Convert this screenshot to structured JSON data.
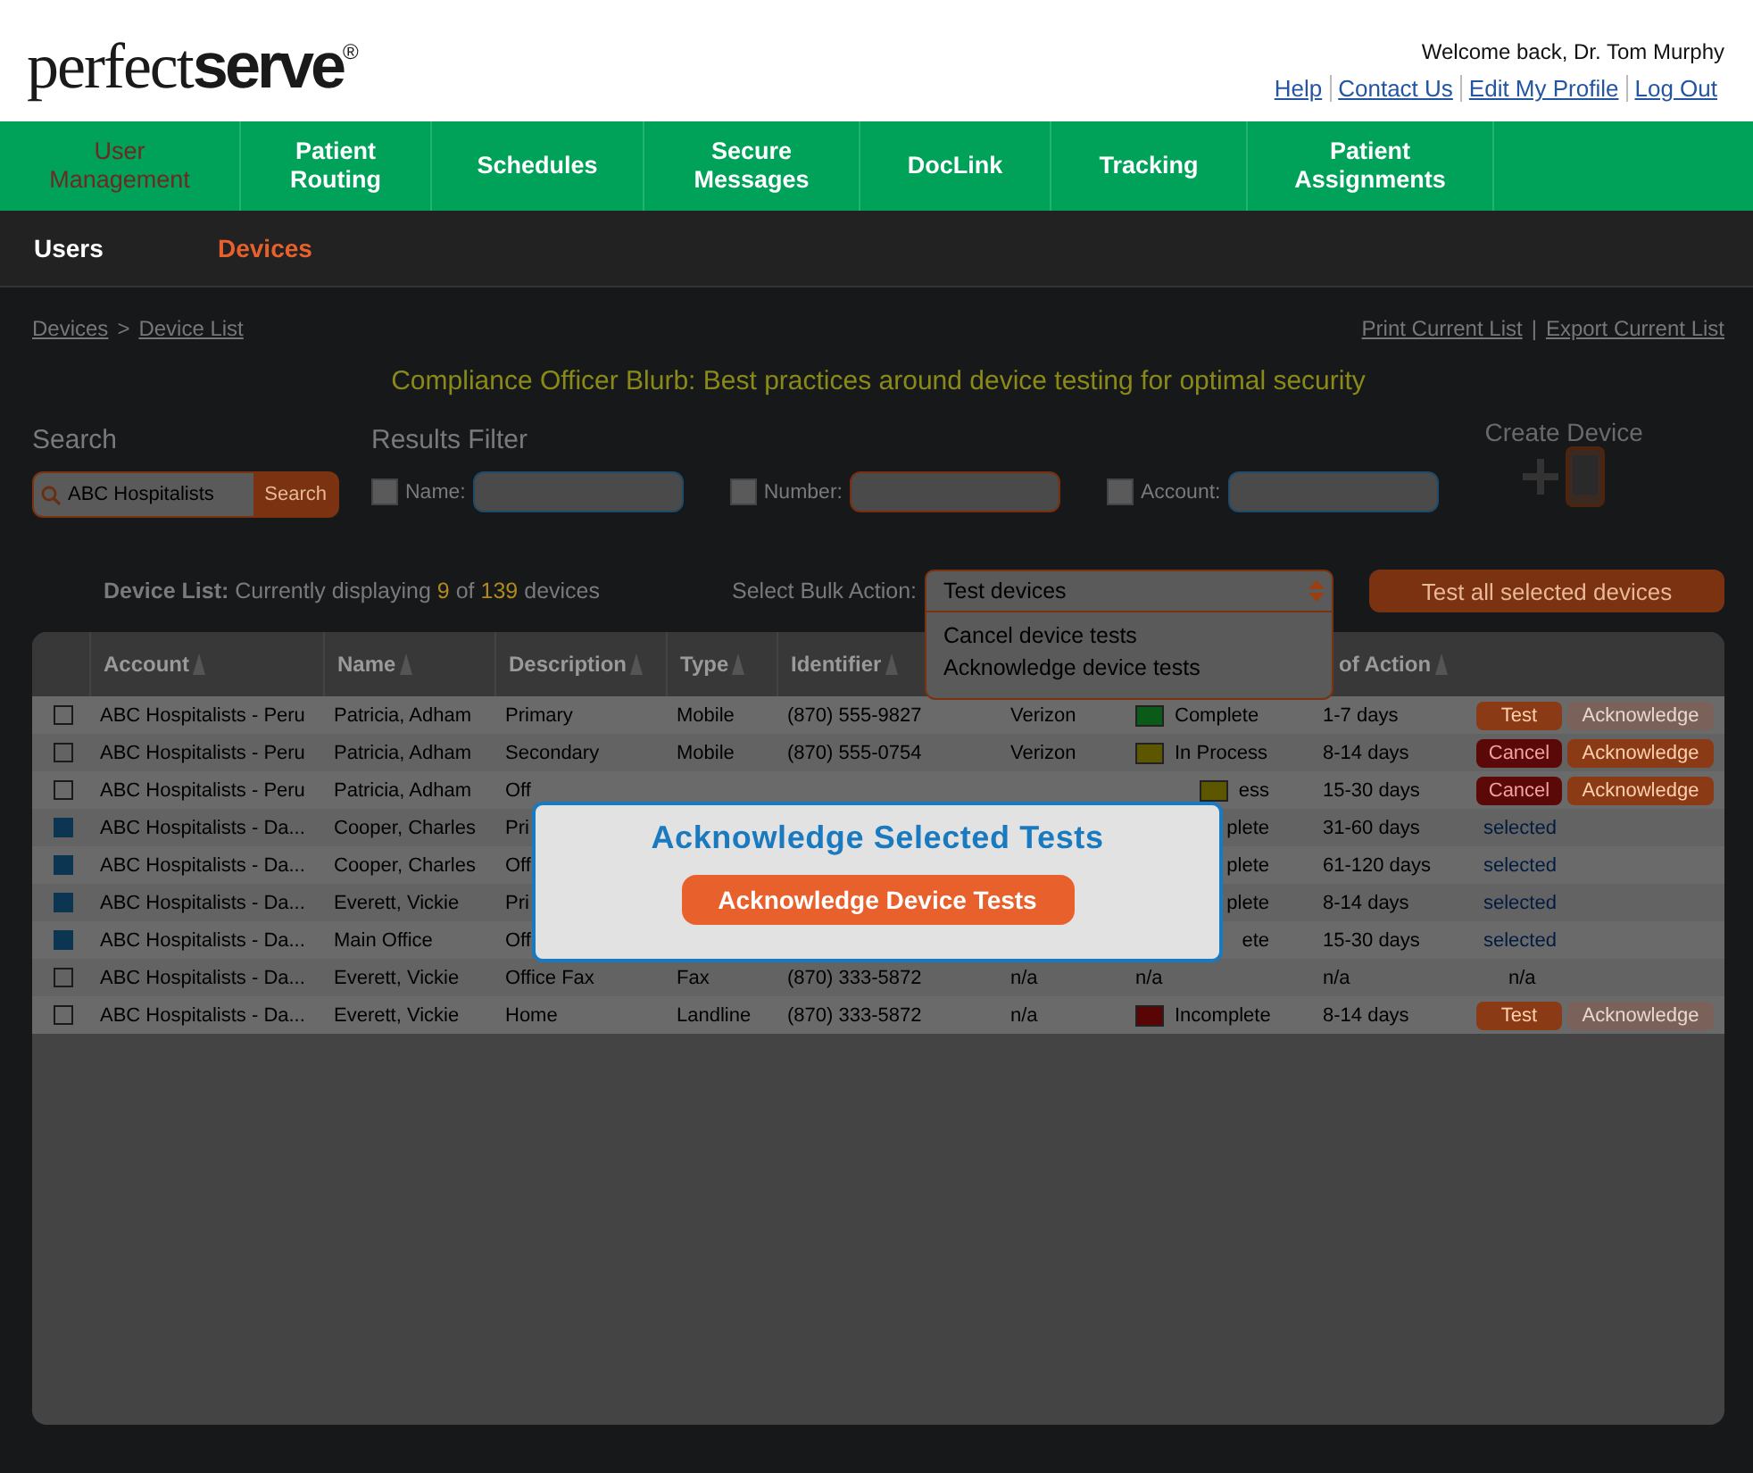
{
  "logo": {
    "light": "perfect",
    "bold": "serve",
    "mark": "®"
  },
  "welcome": "Welcome back, Dr. Tom Murphy",
  "top_links": [
    "Help",
    "Contact Us",
    "Edit My Profile",
    "Log Out"
  ],
  "nav": [
    {
      "label": "User Management",
      "selected": true
    },
    {
      "label": "Patient Routing",
      "selected": false
    },
    {
      "label": "Schedules",
      "selected": false
    },
    {
      "label": "Secure Messages",
      "selected": false
    },
    {
      "label": "DocLink",
      "selected": false
    },
    {
      "label": "Tracking",
      "selected": false
    },
    {
      "label": "Patient Assignments",
      "selected": false
    }
  ],
  "subnav": [
    {
      "label": "Users",
      "selected": false
    },
    {
      "label": "Devices",
      "selected": true
    }
  ],
  "breadcrumbs": {
    "items": [
      "Devices",
      "Device List"
    ],
    "separator": ">"
  },
  "list_links": {
    "items": [
      "Print Current List",
      "Export Current List"
    ],
    "separator": "|"
  },
  "blurb": "Compliance Officer Blurb: Best practices around device testing for optimal security",
  "search": {
    "label": "Search",
    "value": "ABC Hospitalists",
    "button": "Search"
  },
  "results_filter": {
    "label": "Results Filter",
    "filters": [
      {
        "label": "Name:",
        "checked": false,
        "color": "#1f4a6a"
      },
      {
        "label": "Number:",
        "checked": false,
        "color": "#7a2e10"
      },
      {
        "label": "Account:",
        "checked": false,
        "color": "#1f4a6a"
      }
    ]
  },
  "create_device": {
    "label": "Create Device"
  },
  "device_list": {
    "label": "Device List:",
    "prefix": "Currently displaying",
    "shown": "9",
    "middle": "of",
    "total": "139",
    "suffix": "devices"
  },
  "bulk_action": {
    "label": "Select Bulk Action:",
    "value": "Test devices",
    "options": [
      "Cancel device tests",
      "Acknowledge device tests"
    ],
    "button": "Test all selected devices"
  },
  "table": {
    "columns": [
      "Account",
      "Name",
      "Description",
      "Type",
      "Identifier",
      "of Action"
    ],
    "rows": [
      {
        "checked": false,
        "account": "ABC Hospitalists - Peru",
        "name": "Patricia, Adham",
        "description": "Primary",
        "type": "Mobile",
        "identifier": "(870) 555-9827",
        "carrier": "Verizon",
        "status": {
          "label": "Complete",
          "color": "#0b5a17"
        },
        "time": "1-7 days",
        "action": {
          "kind": "buttons",
          "buttons": [
            {
              "label": "Test",
              "kind": "test",
              "disabled": false
            },
            {
              "label": "Acknowledge",
              "kind": "acknowledge",
              "disabled": true
            }
          ]
        }
      },
      {
        "checked": false,
        "account": "ABC Hospitalists - Peru",
        "name": "Patricia, Adham",
        "description": "Secondary",
        "type": "Mobile",
        "identifier": "(870) 555-0754",
        "carrier": "Verizon",
        "status": {
          "label": "In Process",
          "color": "#5c5600"
        },
        "time": "8-14 days",
        "action": {
          "kind": "buttons",
          "buttons": [
            {
              "label": "Cancel",
              "kind": "cancel",
              "disabled": false
            },
            {
              "label": "Acknowledge",
              "kind": "acknowledge",
              "disabled": false
            }
          ]
        }
      },
      {
        "checked": false,
        "account": "ABC Hospitalists - Peru",
        "name": "Patricia, Adham",
        "description": "Off",
        "status": {
          "label": "ess",
          "color": "#5c5600"
        },
        "time": "15-30 days",
        "action": {
          "kind": "buttons",
          "buttons": [
            {
              "label": "Cancel",
              "kind": "cancel",
              "disabled": false
            },
            {
              "label": "Acknowledge",
              "kind": "acknowledge",
              "disabled": false
            }
          ]
        }
      },
      {
        "checked": true,
        "account": "ABC Hospitalists - Da...",
        "name": "Cooper, Charles",
        "description": "Pri",
        "status": {
          "label": "plete"
        },
        "time": "31-60 days",
        "action": {
          "kind": "link",
          "label": "selected"
        }
      },
      {
        "checked": true,
        "account": "ABC Hospitalists - Da...",
        "name": "Cooper, Charles",
        "description": "Off",
        "status": {
          "label": "plete"
        },
        "time": "61-120 days",
        "action": {
          "kind": "link",
          "label": "selected"
        }
      },
      {
        "checked": true,
        "account": "ABC Hospitalists - Da...",
        "name": "Everett, Vickie",
        "description": "Pri",
        "status": {
          "label": "plete"
        },
        "time": "8-14 days",
        "action": {
          "kind": "link",
          "label": "selected"
        }
      },
      {
        "checked": true,
        "account": "ABC Hospitalists - Da...",
        "name": "Main Office",
        "description": "Off",
        "status": {
          "label": "ete"
        },
        "time": "15-30 days",
        "action": {
          "kind": "link",
          "label": "selected"
        }
      },
      {
        "checked": false,
        "account": "ABC Hospitalists - Da...",
        "name": "Everett, Vickie",
        "description": "Office Fax",
        "type": "Fax",
        "identifier": "(870) 333-5872",
        "carrier": "n/a",
        "status": {
          "label": "n/a"
        },
        "time": "n/a",
        "action": {
          "kind": "text",
          "label": "n/a"
        }
      },
      {
        "checked": false,
        "account": "ABC Hospitalists - Da...",
        "name": "Everett, Vickie",
        "description": "Home",
        "type": "Landline",
        "identifier": "(870) 333-5872",
        "carrier": "n/a",
        "status": {
          "label": "Incomplete",
          "color": "#5a0505"
        },
        "time": "8-14 days",
        "action": {
          "kind": "buttons",
          "buttons": [
            {
              "label": "Test",
              "kind": "test",
              "disabled": false
            },
            {
              "label": "Acknowledge",
              "kind": "acknowledge",
              "disabled": true
            }
          ]
        }
      }
    ]
  },
  "modal": {
    "title": "Acknowledge Selected Tests",
    "button": "Acknowledge Device Tests"
  }
}
